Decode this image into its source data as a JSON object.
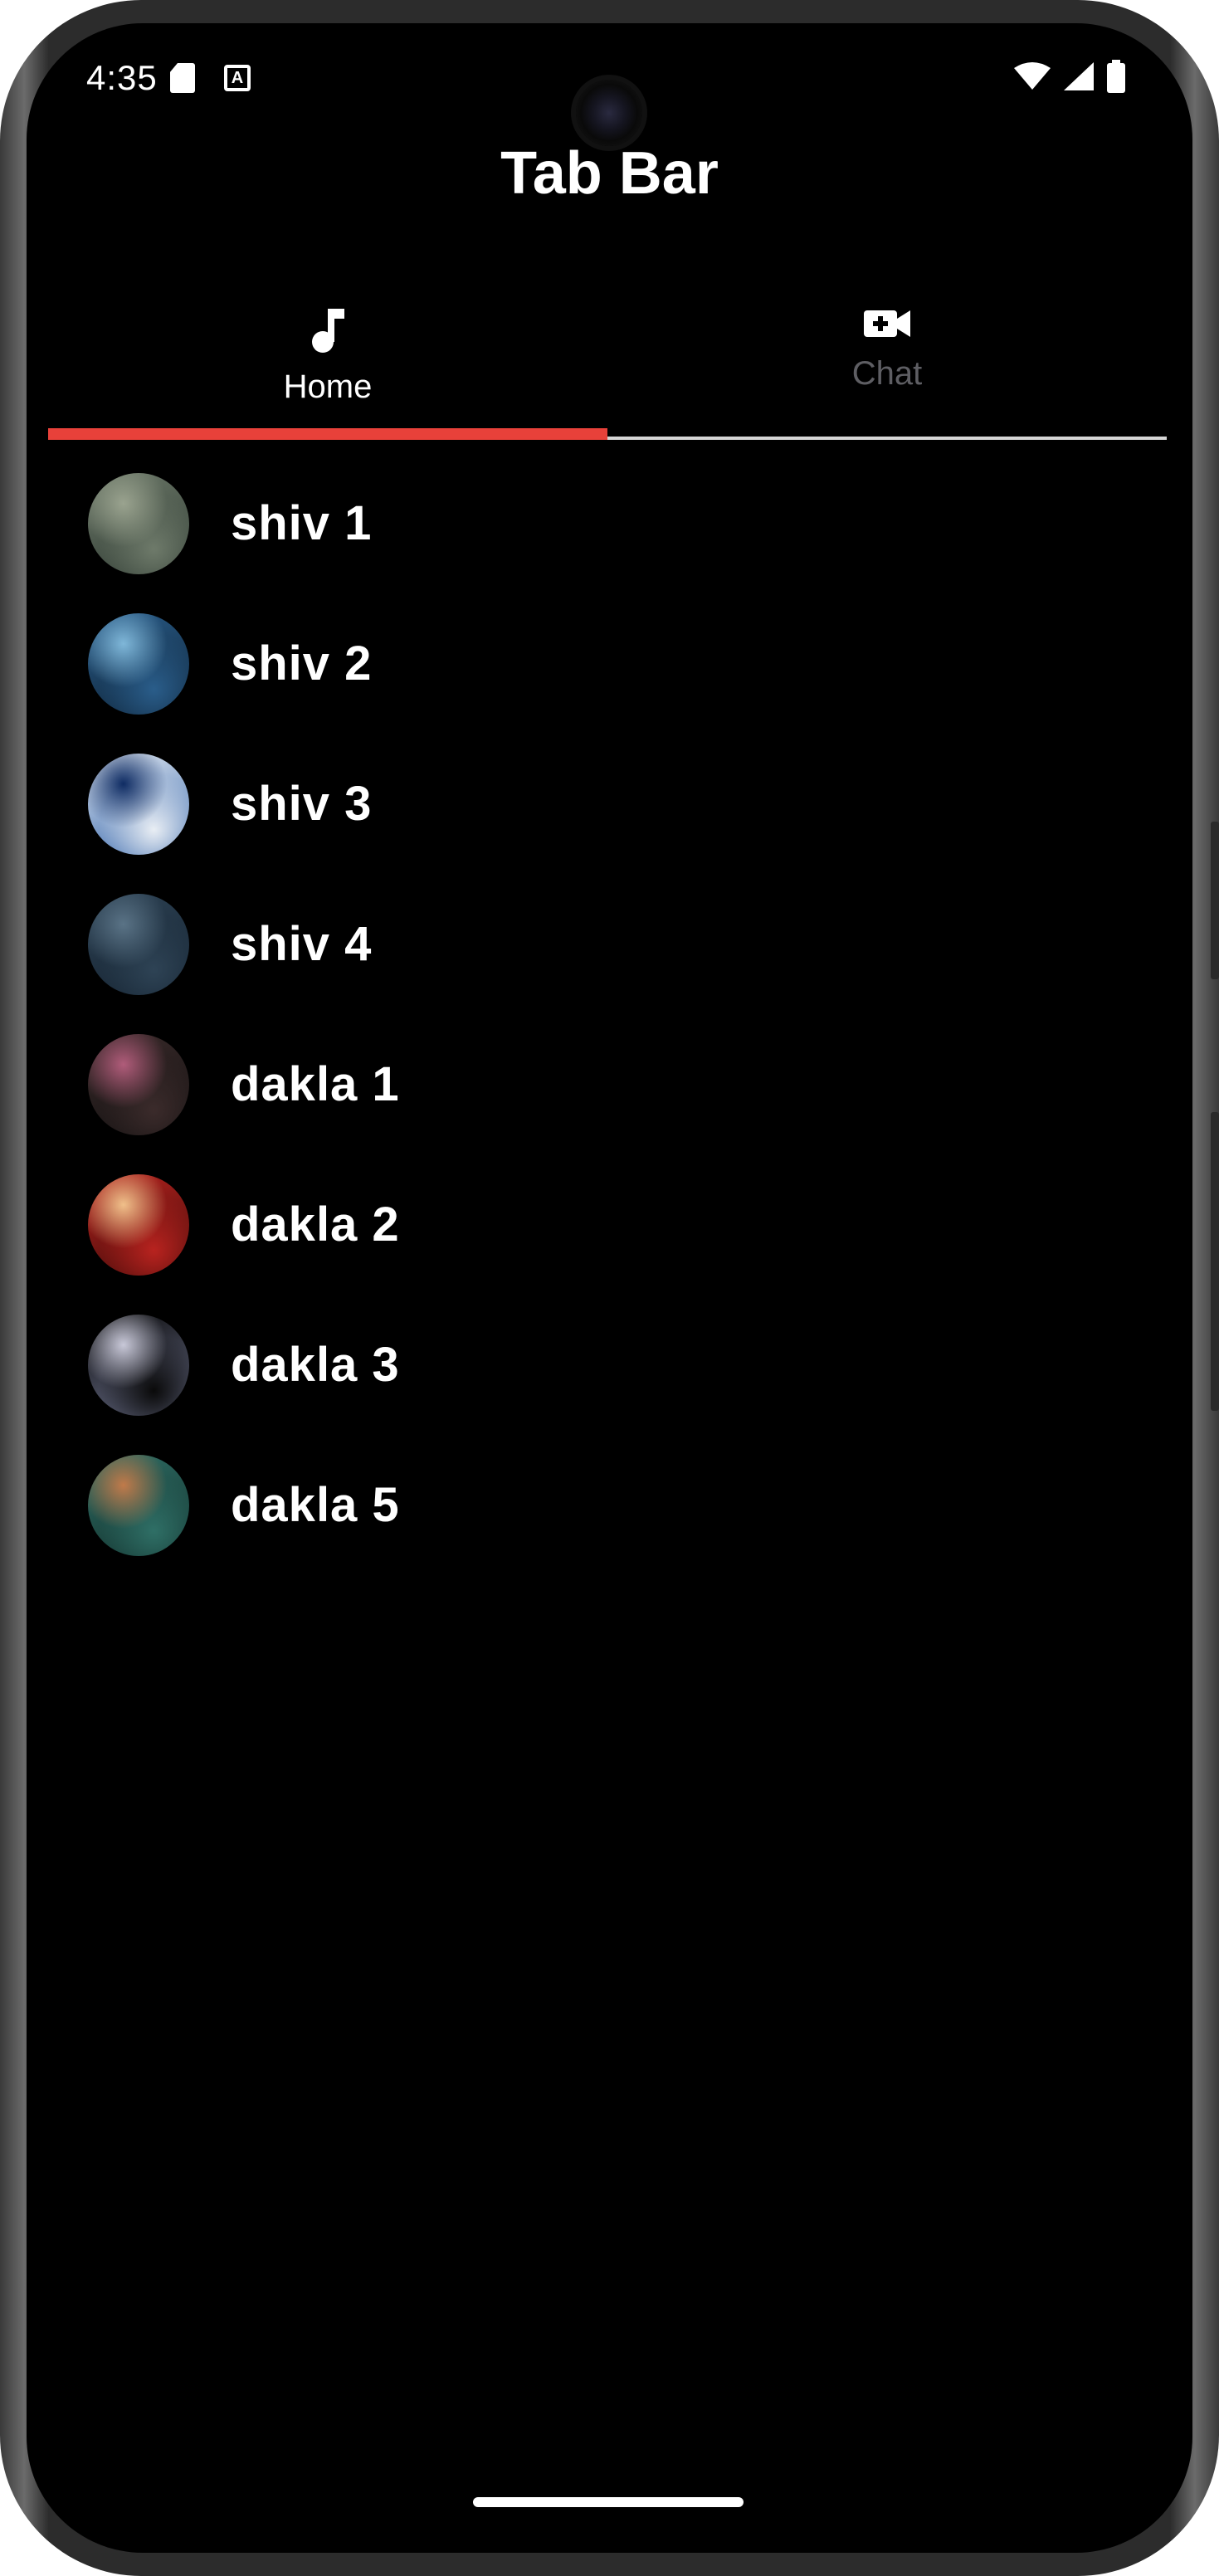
{
  "status_bar": {
    "time": "4:35",
    "icons": [
      "sd-card-icon",
      "font-a-icon",
      "wifi-icon",
      "signal-icon",
      "battery-icon"
    ]
  },
  "app_bar": {
    "title": "Tab Bar"
  },
  "tabs": [
    {
      "label": "Home",
      "icon": "music-note-icon",
      "selected": true
    },
    {
      "label": "Chat",
      "icon": "video-call-icon",
      "selected": false
    }
  ],
  "colors": {
    "background": "#000000",
    "text": "#ffffff",
    "tab_inactive": "#5e5e63",
    "indicator": "#e8413a"
  },
  "songs": [
    {
      "title": "shiv 1",
      "art_colors": [
        "#6e7a6a",
        "#2f3b33",
        "#9aa38f"
      ]
    },
    {
      "title": "shiv 2",
      "art_colors": [
        "#2a5d8a",
        "#0d2236",
        "#7fb7d9"
      ]
    },
    {
      "title": "shiv 3",
      "art_colors": [
        "#e9eef4",
        "#2c5fa8",
        "#0f2c63"
      ]
    },
    {
      "title": "shiv 4",
      "art_colors": [
        "#2e4355",
        "#142230",
        "#5a7386"
      ]
    },
    {
      "title": "dakla 1",
      "art_colors": [
        "#3b2b2b",
        "#121010",
        "#b05c7a"
      ]
    },
    {
      "title": "dakla 2",
      "art_colors": [
        "#b8231f",
        "#3e0a08",
        "#f0c08a"
      ]
    },
    {
      "title": "dakla 3",
      "art_colors": [
        "#0a0a0a",
        "#6a6f8a",
        "#c8c8d8"
      ]
    },
    {
      "title": "dakla 5",
      "art_colors": [
        "#2f6f66",
        "#12302c",
        "#c07a4a"
      ]
    }
  ]
}
